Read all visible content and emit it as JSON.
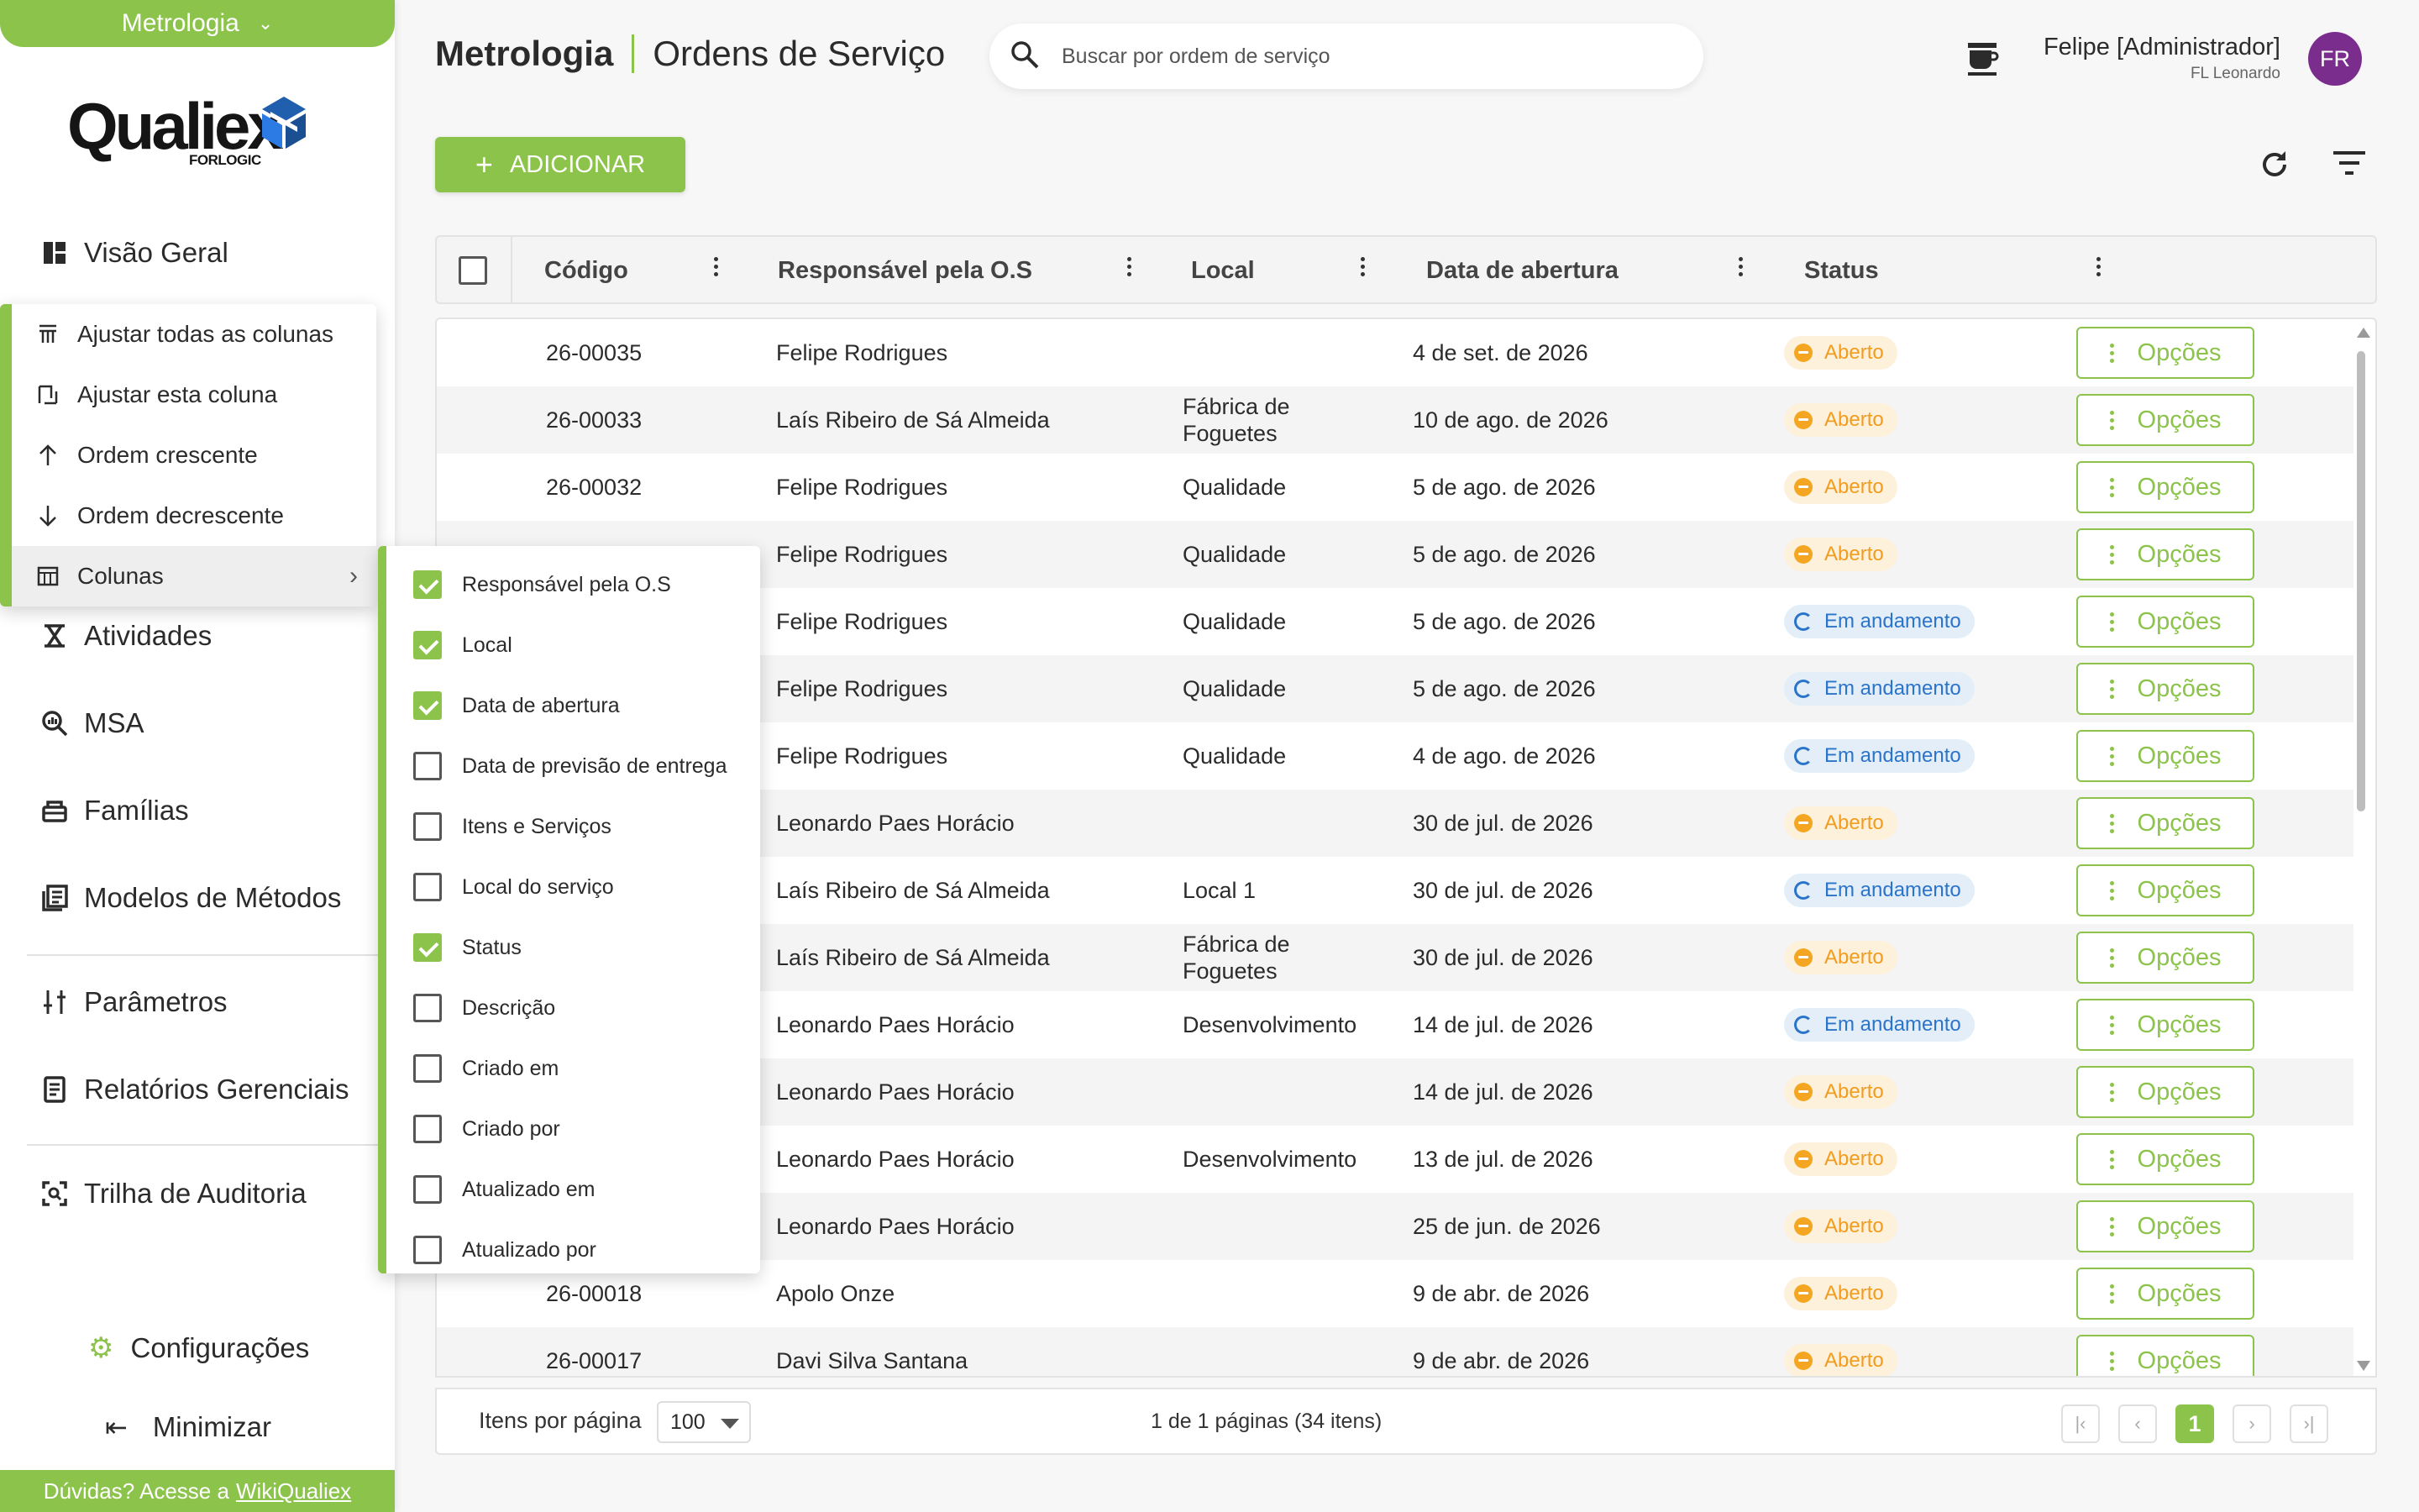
{
  "sidebar": {
    "module": "Metrologia",
    "logo_word": "Qualiex",
    "logo_sub": "FORLOGIC",
    "nav": [
      {
        "label": "Visão Geral",
        "icon": "dashboard-icon"
      },
      {
        "label": "Atividades",
        "icon": "activities-icon"
      },
      {
        "label": "MSA",
        "icon": "msa-search-icon"
      },
      {
        "label": "Famílias",
        "icon": "families-icon"
      },
      {
        "label": "Modelos de Métodos",
        "icon": "method-models-icon"
      },
      {
        "label": "Parâmetros",
        "icon": "parameters-icon"
      },
      {
        "label": "Relatórios Gerenciais",
        "icon": "reports-icon"
      },
      {
        "label": "Trilha de Auditoria",
        "icon": "audit-trail-icon"
      }
    ],
    "config": "Configurações",
    "minimize": "Minimizar",
    "help_text": "Dúvidas? Acesse a",
    "help_link": "WikiQualiex"
  },
  "header": {
    "module": "Metrologia",
    "page": "Ordens de Serviço",
    "search_placeholder": "Buscar por ordem de serviço",
    "user_name": "Felipe [Administrador]",
    "user_sub": "FL Leonardo",
    "avatar_initials": "FR"
  },
  "toolbar": {
    "add_label": "ADICIONAR"
  },
  "table": {
    "columns": [
      "Código",
      "Responsável pela O.S",
      "Local",
      "Data de abertura",
      "Status"
    ],
    "options_label": "Opções",
    "rows": [
      {
        "code": "26-00035",
        "resp": "Felipe Rodrigues",
        "local": "",
        "date": "4 de set. de 2026",
        "status": "Aberto",
        "kind": "open"
      },
      {
        "code": "26-00033",
        "resp": "Laís Ribeiro de Sá Almeida",
        "local": "Fábrica de\nFoguetes",
        "date": "10 de ago. de 2026",
        "status": "Aberto",
        "kind": "open"
      },
      {
        "code": "26-00032",
        "resp": "Felipe Rodrigues",
        "local": "Qualidade",
        "date": "5 de ago. de 2026",
        "status": "Aberto",
        "kind": "open"
      },
      {
        "code": "",
        "resp": "Felipe Rodrigues",
        "local": "Qualidade",
        "date": "5 de ago. de 2026",
        "status": "Aberto",
        "kind": "open"
      },
      {
        "code": "",
        "resp": "Felipe Rodrigues",
        "local": "Qualidade",
        "date": "5 de ago. de 2026",
        "status": "Em andamento",
        "kind": "prog"
      },
      {
        "code": "",
        "resp": "Felipe Rodrigues",
        "local": "Qualidade",
        "date": "5 de ago. de 2026",
        "status": "Em andamento",
        "kind": "prog"
      },
      {
        "code": "",
        "resp": "Felipe Rodrigues",
        "local": "Qualidade",
        "date": "4 de ago. de 2026",
        "status": "Em andamento",
        "kind": "prog"
      },
      {
        "code": "",
        "resp": "Leonardo Paes Horácio",
        "local": "",
        "date": "30 de jul. de 2026",
        "status": "Aberto",
        "kind": "open"
      },
      {
        "code": "",
        "resp": "Laís Ribeiro de Sá Almeida",
        "local": "Local 1",
        "date": "30 de jul. de 2026",
        "status": "Em andamento",
        "kind": "prog"
      },
      {
        "code": "",
        "resp": "Laís Ribeiro de Sá Almeida",
        "local": "Fábrica de\nFoguetes",
        "date": "30 de jul. de 2026",
        "status": "Aberto",
        "kind": "open"
      },
      {
        "code": "",
        "resp": "Leonardo Paes Horácio",
        "local": "Desenvolvimento",
        "date": "14 de jul. de 2026",
        "status": "Em andamento",
        "kind": "prog"
      },
      {
        "code": "",
        "resp": "Leonardo Paes Horácio",
        "local": "",
        "date": "14 de jul. de 2026",
        "status": "Aberto",
        "kind": "open"
      },
      {
        "code": "",
        "resp": "Leonardo Paes Horácio",
        "local": "Desenvolvimento",
        "date": "13 de jul. de 2026",
        "status": "Aberto",
        "kind": "open"
      },
      {
        "code": "",
        "resp": "Leonardo Paes Horácio",
        "local": "",
        "date": "25 de jun. de 2026",
        "status": "Aberto",
        "kind": "open"
      },
      {
        "code": "26-00018",
        "resp": "Apolo Onze",
        "local": "",
        "date": "9 de abr. de 2026",
        "status": "Aberto",
        "kind": "open"
      },
      {
        "code": "26-00017",
        "resp": "Davi Silva Santana",
        "local": "",
        "date": "9 de abr. de 2026",
        "status": "Aberto",
        "kind": "open"
      }
    ]
  },
  "footer": {
    "items_per_page_label": "Itens por página",
    "items_per_page_value": "100",
    "pages_text": "1 de 1 páginas (34 itens)",
    "current_page": "1"
  },
  "column_menu": {
    "items": [
      {
        "label": "Ajustar todas as colunas",
        "icon": "fit-all-columns-icon"
      },
      {
        "label": "Ajustar esta coluna",
        "icon": "fit-column-icon"
      },
      {
        "label": "Ordem crescente",
        "icon": "arrow-up-icon"
      },
      {
        "label": "Ordem decrescente",
        "icon": "arrow-down-icon"
      },
      {
        "label": "Colunas",
        "icon": "columns-grid-icon"
      }
    ]
  },
  "columns_submenu": {
    "items": [
      {
        "label": "Responsável pela O.S",
        "checked": true
      },
      {
        "label": "Local",
        "checked": true
      },
      {
        "label": "Data de abertura",
        "checked": true
      },
      {
        "label": "Data de previsão de entrega",
        "checked": false
      },
      {
        "label": "Itens e Serviços",
        "checked": false
      },
      {
        "label": "Local do serviço",
        "checked": false
      },
      {
        "label": "Status",
        "checked": true
      },
      {
        "label": "Descrição",
        "checked": false
      },
      {
        "label": "Criado em",
        "checked": false
      },
      {
        "label": "Criado por",
        "checked": false
      },
      {
        "label": "Atualizado em",
        "checked": false
      },
      {
        "label": "Atualizado por",
        "checked": false
      }
    ]
  },
  "colors": {
    "accent": "#8cc34b",
    "open": "#f29c1e",
    "progress": "#2a74c9",
    "avatar": "#7b2d8e"
  }
}
